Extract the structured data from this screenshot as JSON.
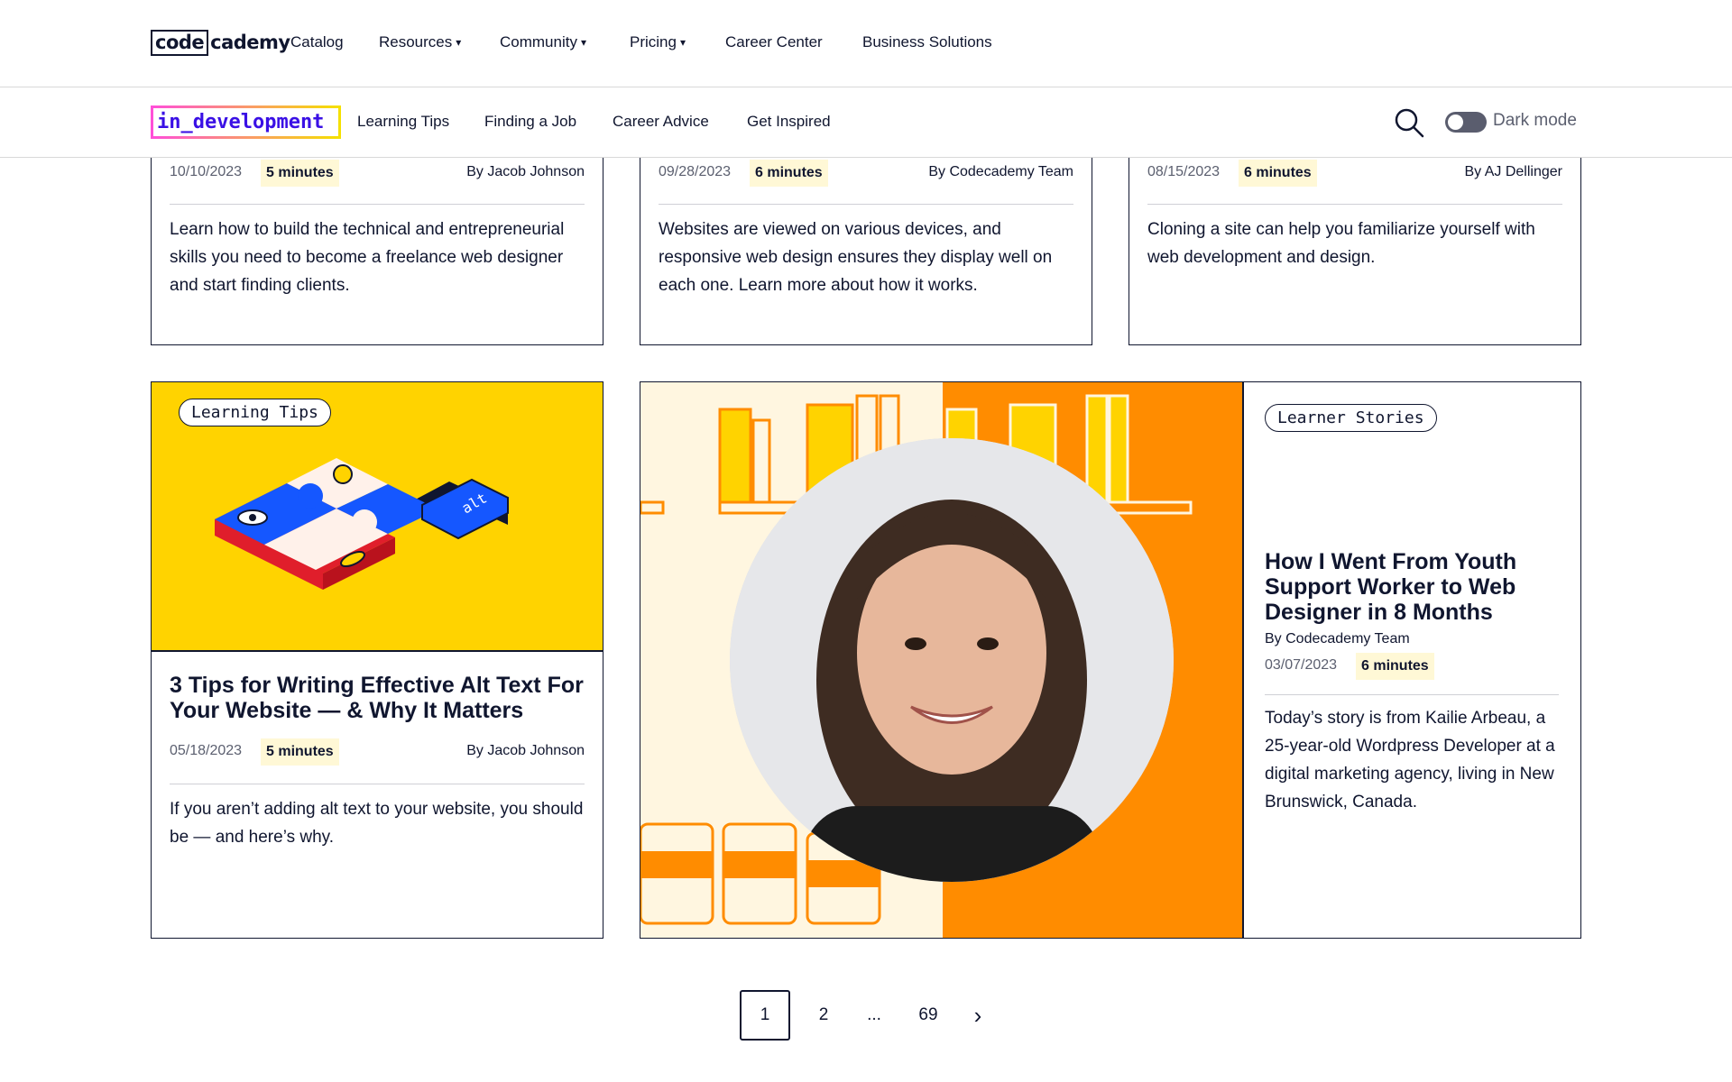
{
  "brand": {
    "logo_box": "code",
    "logo_rest": "cademy"
  },
  "topnav": {
    "catalog": "Catalog",
    "resources": "Resources",
    "community": "Community",
    "pricing": "Pricing",
    "career_center": "Career Center",
    "business": "Business Solutions",
    "caret": "▾"
  },
  "subnav": {
    "brand": "in_development",
    "items": [
      "Learning Tips",
      "Finding a Job",
      "Career Advice",
      "Get Inspired"
    ],
    "dark_mode": "Dark mode"
  },
  "articles_top": [
    {
      "date": "10/10/2023",
      "minutes": "5 minutes",
      "author": "By Jacob Johnson",
      "description": "Learn how to build the technical and entrepreneurial skills you need to become a freelance web designer and start finding clients."
    },
    {
      "date": "09/28/2023",
      "minutes": "6 minutes",
      "author": "By Codecademy Team",
      "description": "Websites are viewed on various devices, and responsive web design ensures they display well on each one. Learn more about how it works."
    },
    {
      "date": "08/15/2023",
      "minutes": "6 minutes",
      "author": "By AJ Dellinger",
      "description": "Cloning a site can help you familiarize yourself with web development and design."
    }
  ],
  "article_alt": {
    "tag": "Learning Tips",
    "title": "3 Tips for Writing Effective Alt Text For Your Website — & Why It Matters",
    "date": "05/18/2023",
    "minutes": "5 minutes",
    "author": "By Jacob Johnson",
    "description": "If you aren’t adding alt text to your website, you should be — and here’s why.",
    "puzzle_text": "alt"
  },
  "article_story": {
    "tag": "Learner Stories",
    "title": "How I Went From Youth Support Worker to Web Designer in 8 Months",
    "author": "By Codecademy Team",
    "date": "03/07/2023",
    "minutes": "6 minutes",
    "description": "Today’s story is from Kailie Arbeau, a 25-year-old Wordpress Developer at a digital marketing agency, living in New Brunswick, Canada."
  },
  "pagination": {
    "pages": [
      "1",
      "2",
      "...",
      "69"
    ],
    "current": "1",
    "next": "›"
  },
  "colors": {
    "yellow": "#ffd300",
    "blue": "#1557ff",
    "red": "#e01e2b",
    "orange": "#ff8c00",
    "cream": "#fff6e0",
    "navy": "#10162f",
    "purple": "#3a10e5"
  },
  "icons": [
    "search-icon",
    "chevron-right-icon",
    "toggle-switch"
  ]
}
